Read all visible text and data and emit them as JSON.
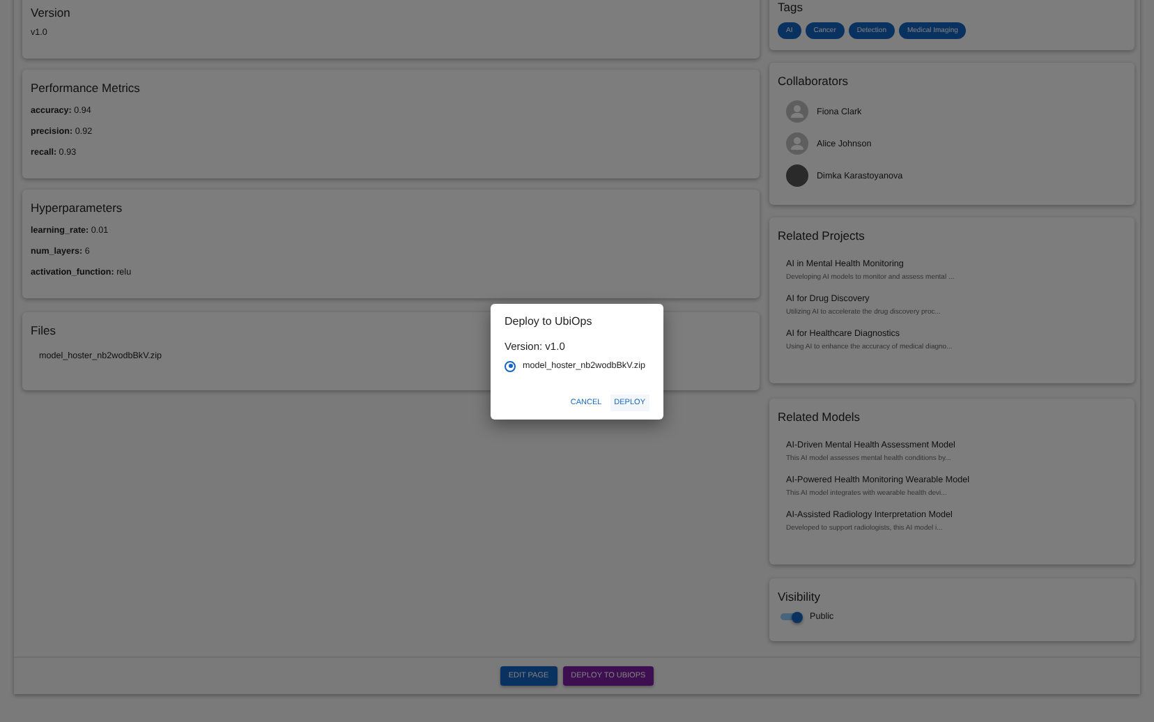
{
  "tags": {
    "title": "Tags",
    "items": [
      "AI",
      "Cancer",
      "Detection",
      "Medical Imaging"
    ]
  },
  "version": {
    "title": "Version",
    "value": "v1.0"
  },
  "performance_metrics": {
    "title": "Performance Metrics",
    "items": [
      "**accuracy:** 0.94",
      "**precision:** 0.92",
      "**recall:** 0.93"
    ]
  },
  "hyperparameters": {
    "title": "Hyperparameters",
    "items": [
      "**learning_rate:** 0.01",
      "**num_layers:** 6",
      "**activation_function:** relu"
    ]
  },
  "files": {
    "title": "Files",
    "items": [
      "model_hoster_nb2wodbBkV.zip"
    ]
  },
  "collaborators": {
    "title": "Collaborators",
    "people": [
      {
        "name": "Fiona Clark",
        "kind": "silhouette"
      },
      {
        "name": "Alice Johnson",
        "kind": "silhouette"
      },
      {
        "name": "Dimka Karastoyanova",
        "kind": "photo"
      }
    ]
  },
  "related_projects": {
    "title": "Related Projects",
    "items": [
      {
        "title": "AI in Mental Health Monitoring",
        "description": "Developing AI models to monitor and assess mental ..."
      },
      {
        "title": "AI for Drug Discovery",
        "description": "Utilizing AI to accelerate the drug discovery proc..."
      },
      {
        "title": "AI for Healthcare Diagnostics",
        "description": "Using AI to enhance the accuracy of medical diagno..."
      }
    ]
  },
  "related_models": {
    "title": "Related Models",
    "items": [
      {
        "title": "AI-Driven Mental Health Assessment Model",
        "description": "This AI model assesses mental health conditions by..."
      },
      {
        "title": "AI-Powered Health Monitoring Wearable Model",
        "description": "This AI model integrates with wearable health devi..."
      },
      {
        "title": "AI-Assisted Radiology Interpretation Model",
        "description": "Developed to support radiologists, this AI model i..."
      }
    ]
  },
  "visibility": {
    "title": "Visibility",
    "label": "Public",
    "on": true
  },
  "actions": [
    {
      "label": "EDIT PAGE",
      "kind": "primary"
    },
    {
      "label": "DEPLOY TO UBIOPS",
      "kind": "secondary"
    }
  ],
  "dialog": {
    "title": "Deploy to UbiOps",
    "version": "Version: v1.0",
    "options": [
      {
        "label": "model_hoster_nb2wodbBkV.zip",
        "selected": true
      }
    ],
    "buttons": [
      "CANCEL",
      "DEPLOY"
    ]
  }
}
